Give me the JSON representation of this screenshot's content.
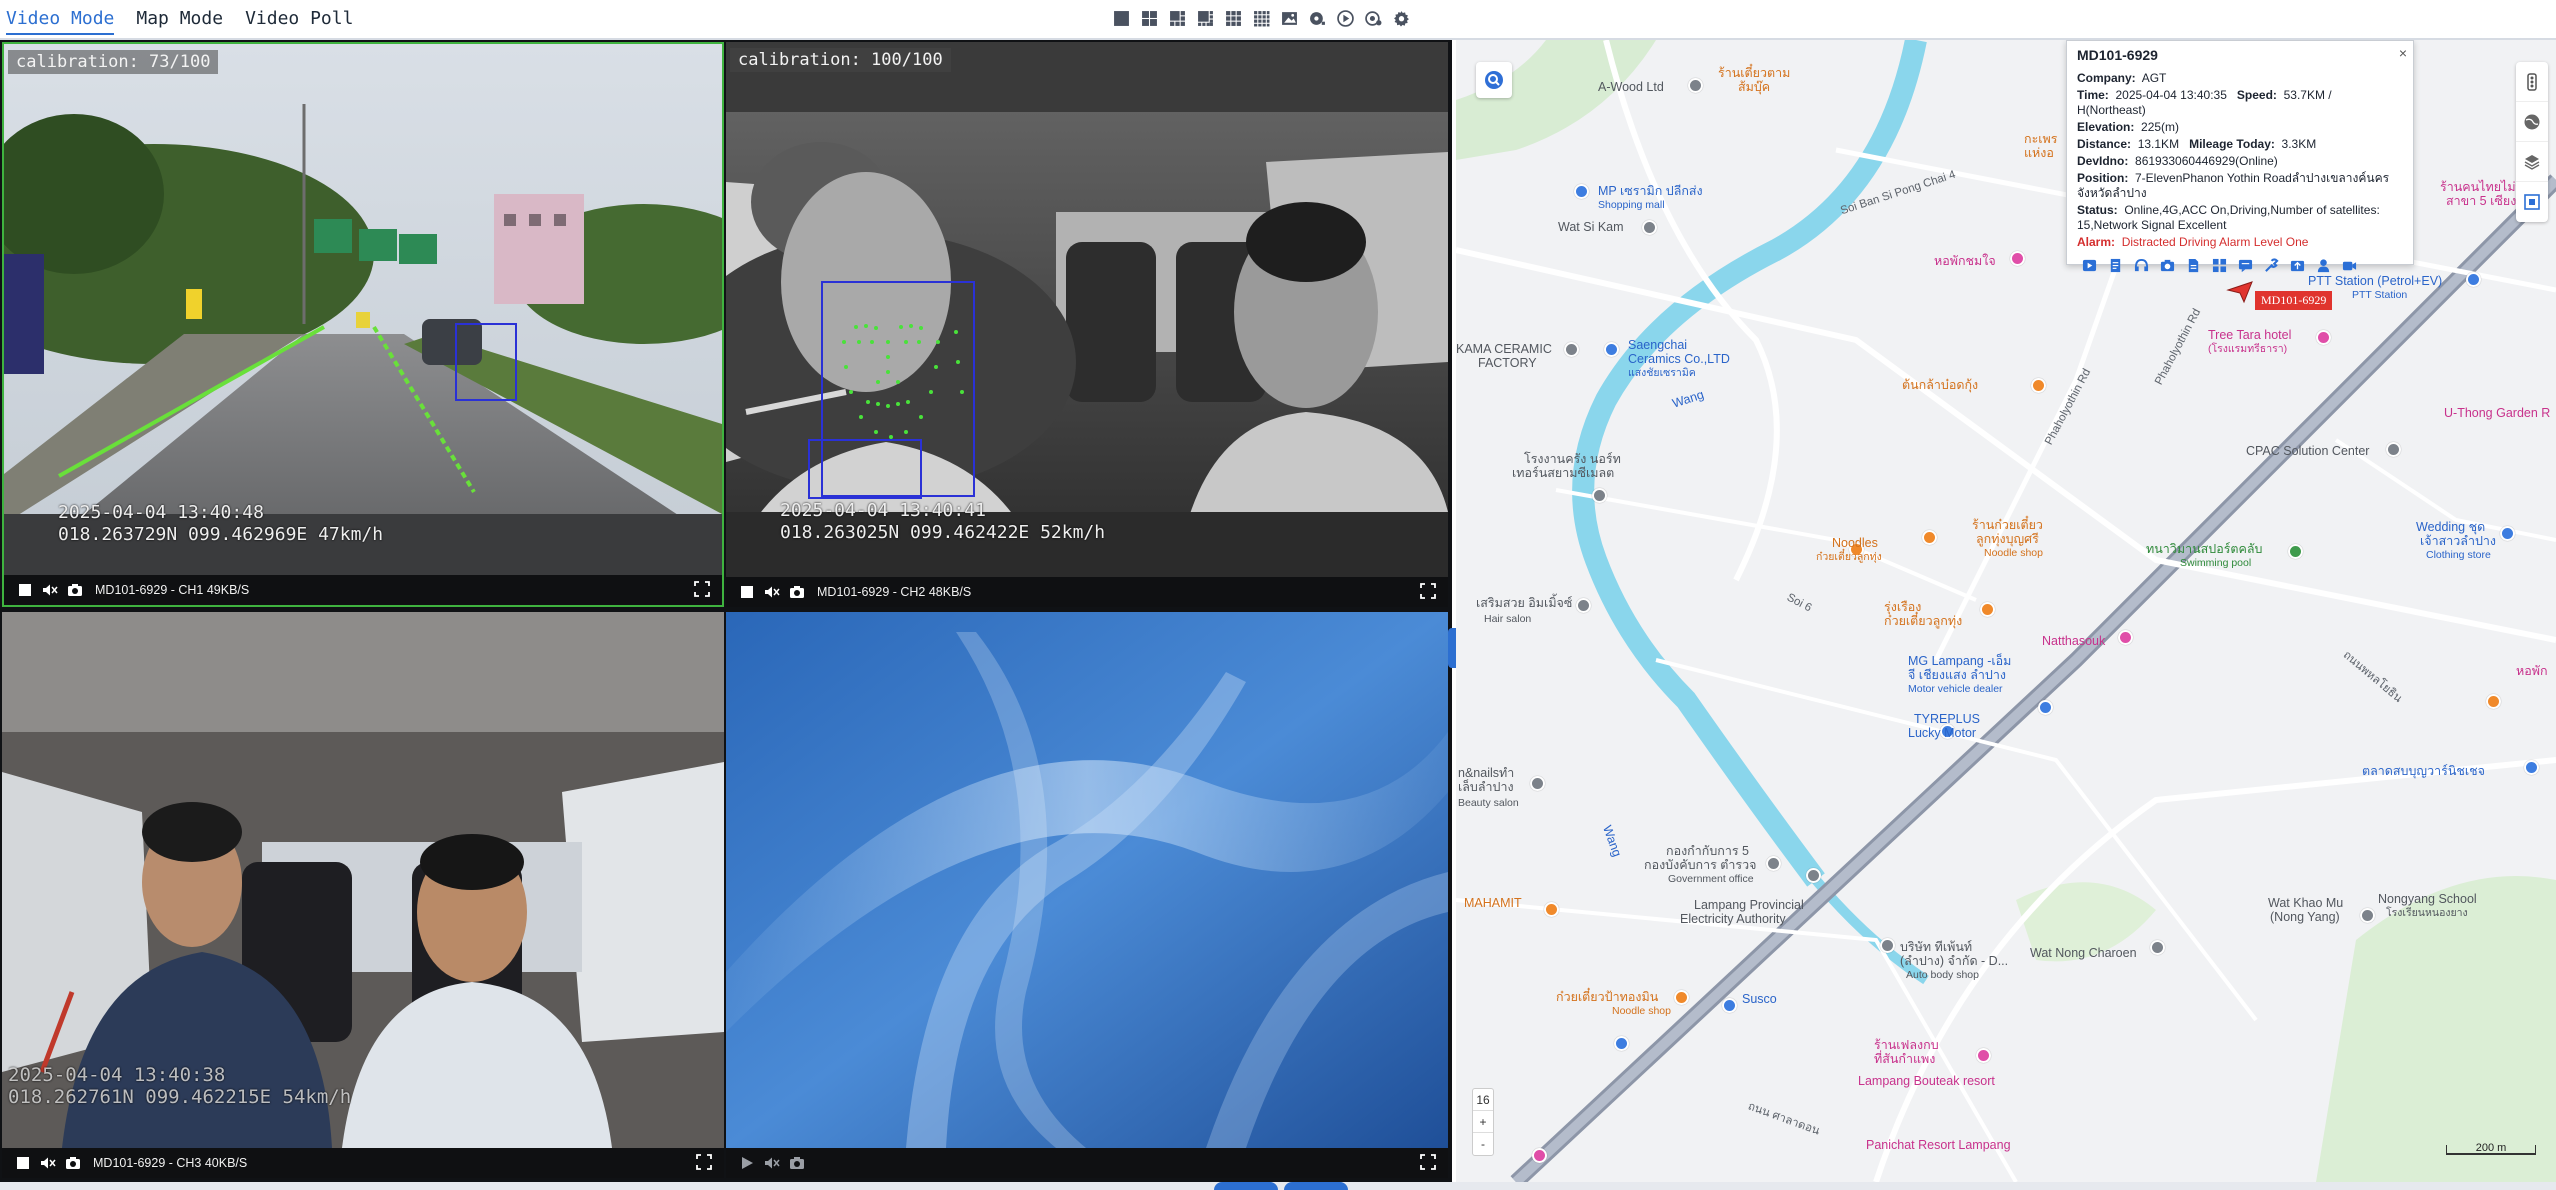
{
  "modes": {
    "video_mode": "Video Mode",
    "map_mode": "Map Mode",
    "video_poll": "Video Poll",
    "active": "Video Mode"
  },
  "toolbar_icons": [
    "layout-1-icon",
    "layout-4-icon",
    "layout-6-icon",
    "layout-8-icon",
    "layout-9-icon",
    "layout-16-icon",
    "image-icon",
    "record-settings-icon",
    "play-icon",
    "camera-settings-icon",
    "gear-icon"
  ],
  "channels": [
    {
      "calibration": "calibration: 73/100",
      "osd_time": "2025-04-04 13:40:48",
      "osd_pos": "018.263729N 099.462969E 47km/h",
      "label": "MD101-6929 - CH1 49KB/S",
      "playing": true
    },
    {
      "calibration": "calibration: 100/100",
      "osd_time": "2025-04-04 13:40:41",
      "osd_pos": "018.263025N 099.462422E 52km/h",
      "label": "MD101-6929 - CH2 48KB/S",
      "playing": true
    },
    {
      "calibration": "",
      "osd_time": "2025-04-04 13:40:38",
      "osd_pos": "018.262761N 099.462215E 54km/h",
      "label": "MD101-6929 - CH3 40KB/S",
      "playing": true
    },
    {
      "calibration": "",
      "osd_time": "",
      "osd_pos": "",
      "label": "",
      "playing": false
    }
  ],
  "popup": {
    "title": "MD101-6929",
    "close": "×",
    "company_label": "Company:",
    "company": "AGT",
    "time_label": "Time:",
    "time": "2025-04-04 13:40:35",
    "speed_label": "Speed:",
    "speed": "53.7KM / H(Northeast)",
    "elevation_label": "Elevation:",
    "elevation": "225(m)",
    "distance_label": "Distance:",
    "distance": "13.1KM",
    "mileage_label": "Mileage Today:",
    "mileage": "3.3KM",
    "devidno_label": "DevIdno:",
    "devidno": "861933060446929(Online)",
    "position_label": "Position:",
    "position": "7-ElevenPhanon Yothin Roadลำปางเขลางค์นครจังหวัดลำปาง",
    "status_label": "Status:",
    "status": "Online,4G,ACC On,Driving,Number of satellites: 15,Network Signal Excellent",
    "alarm_label": "Alarm:",
    "alarm": "Distracted Driving Alarm Level One",
    "alarm_color": "#d42e2e",
    "actions": [
      "play-video-icon",
      "document-icon",
      "headset-icon",
      "snapshot-icon",
      "file-icon",
      "grid-icon",
      "message-icon",
      "tools-icon",
      "upload-icon",
      "driver-icon",
      "video-record-icon"
    ]
  },
  "vehicle_tag": "MD101-6929",
  "map_labels": [
    {
      "text": "A-Wood Ltd",
      "cls": "gray"
    },
    {
      "text": "ร้านเตี๋ยวตาม",
      "cls": "orange"
    },
    {
      "text": "ส้มบุ๊ค",
      "cls": "orange"
    },
    {
      "text": "กะเพร",
      "cls": "orange"
    },
    {
      "text": "แห่งอ",
      "cls": "orange"
    },
    {
      "text": "MP เซรามิก ปลีกส่ง",
      "cls": "blue"
    },
    {
      "text": "Shopping mall",
      "cls": "blue"
    },
    {
      "text": "Wat Si Kam",
      "cls": "gray"
    },
    {
      "text": "หอพักชมใจ",
      "cls": "pink"
    },
    {
      "text": "PTT Station (Petrol+EV)",
      "cls": "blue"
    },
    {
      "text": "PTT Station",
      "cls": "blue"
    },
    {
      "text": "Tree Tara hotel",
      "cls": "pink"
    },
    {
      "text": "(โรงแรมทรีธารา)",
      "cls": "pink"
    },
    {
      "text": "KAMA CERAMIC",
      "cls": "gray"
    },
    {
      "text": "FACTORY",
      "cls": "gray"
    },
    {
      "text": "Saengchai",
      "cls": "blue"
    },
    {
      "text": "Ceramics Co.,LTD",
      "cls": "blue"
    },
    {
      "text": "แสงชัยเซรามิค",
      "cls": "blue"
    },
    {
      "text": "ต้นกล้าบ๋อดกุ้ง",
      "cls": "orange"
    },
    {
      "text": "U-Thong Garden R",
      "cls": "pink"
    },
    {
      "text": "CPAC Solution Center",
      "cls": "gray"
    },
    {
      "text": "โรงงานครัง นอร์ท",
      "cls": "gray"
    },
    {
      "text": "เทอร์นสยามซีเมลต",
      "cls": "gray"
    },
    {
      "text": "ร้านก๋วยเตี๋ยว",
      "cls": "orange"
    },
    {
      "text": "ลูกทุ่งบุญศรี",
      "cls": "orange"
    },
    {
      "text": "Noodle shop",
      "cls": "orange"
    },
    {
      "text": "Noodles",
      "cls": "orange"
    },
    {
      "text": "ก๋วยเตี๋ยวลูกทุ่ง",
      "cls": "orange"
    },
    {
      "text": "Wedding ชุด",
      "cls": "blue"
    },
    {
      "text": "เจ้าสาวลำปาง",
      "cls": "blue"
    },
    {
      "text": "Clothing store",
      "cls": "blue"
    },
    {
      "text": "ทนาวิมานสปอร์ตคลับ",
      "cls": "green"
    },
    {
      "text": "Swimming pool",
      "cls": "green"
    },
    {
      "text": "เสริมสวย อิมเมิ้จซ์",
      "cls": "gray"
    },
    {
      "text": "Hair salon",
      "cls": "gray"
    },
    {
      "text": "รุ่งเรือง",
      "cls": "orange"
    },
    {
      "text": "ก๋วยเตี๋ยวลูกทุ่ง",
      "cls": "orange"
    },
    {
      "text": "Natthasouk",
      "cls": "pink"
    },
    {
      "text": "MG Lampang -เอ็ม",
      "cls": "blue"
    },
    {
      "text": "จี เชียงแสง ลำปาง",
      "cls": "blue"
    },
    {
      "text": "Motor vehicle dealer",
      "cls": "blue"
    },
    {
      "text": "TYREPLUS",
      "cls": "blue"
    },
    {
      "text": "Lucky Motor",
      "cls": "blue"
    },
    {
      "text": "n&nailsทำ",
      "cls": "gray"
    },
    {
      "text": "เล็บลำปาง",
      "cls": "gray"
    },
    {
      "text": "Beauty salon",
      "cls": "gray"
    },
    {
      "text": "กองกำกับการ 5",
      "cls": "gray"
    },
    {
      "text": "กองบังคับการ ตำรวจ",
      "cls": "gray"
    },
    {
      "text": "Government office",
      "cls": "gray"
    },
    {
      "text": "Lampang Provincial",
      "cls": "gray"
    },
    {
      "text": "Electricity Authority",
      "cls": "gray"
    },
    {
      "text": "MAHAMIT",
      "cls": "orange"
    },
    {
      "text": "บริษัท ทีเพ้นท์",
      "cls": "gray"
    },
    {
      "text": "(ลำปาง) จำกัด - D...",
      "cls": "gray"
    },
    {
      "text": "Auto body shop",
      "cls": "gray"
    },
    {
      "text": "Wat Nong Charoen",
      "cls": "gray"
    },
    {
      "text": "Wat Khao Mu",
      "cls": "gray"
    },
    {
      "text": "(Nong Yang)",
      "cls": "gray"
    },
    {
      "text": "Nongyang School",
      "cls": "gray"
    },
    {
      "text": "โรงเรียนหนองยาง",
      "cls": "gray"
    },
    {
      "text": "ตลาดสบบุญวาร์นิชเชจ",
      "cls": "blue"
    },
    {
      "text": "ก๋วยเตี๋ยวป้าทองมิน",
      "cls": "orange"
    },
    {
      "text": "Noodle shop",
      "cls": "orange"
    },
    {
      "text": "Susco",
      "cls": "blue"
    },
    {
      "text": "ร้านเฟลงกบ",
      "cls": "pink"
    },
    {
      "text": "ที่สันกำแพง",
      "cls": "pink"
    },
    {
      "text": "Lampang Bouteak resort",
      "cls": "pink"
    },
    {
      "text": "Panichat Resort Lampang",
      "cls": "pink"
    },
    {
      "text": "Wang",
      "cls": "blue"
    },
    {
      "text": "Wang",
      "cls": "blue"
    },
    {
      "text": "Phaholyothin Rd",
      "cls": "road"
    },
    {
      "text": "Phaholyothin Rd",
      "cls": "road"
    },
    {
      "text": "Soi Ban Si Pong Chai 4",
      "cls": "road"
    },
    {
      "text": "Soi 6",
      "cls": "road"
    },
    {
      "text": "ถนน ศาลาดอน",
      "cls": "road"
    },
    {
      "text": "ถนนพหลโยธิน",
      "cls": "road"
    },
    {
      "text": "ร้านคนไทยไม่ทิ้ง",
      "cls": "pink"
    },
    {
      "text": "สาขา 5 เซียง",
      "cls": "pink"
    },
    {
      "text": "หอพัก",
      "cls": "pink"
    }
  ],
  "map_zoom": "16",
  "zoom_in": "+",
  "zoom_out": "-",
  "scale": "200 m",
  "right_tools": [
    "traffic-icon",
    "satellite-icon",
    "layers-icon",
    "fullscreen-map-icon"
  ]
}
